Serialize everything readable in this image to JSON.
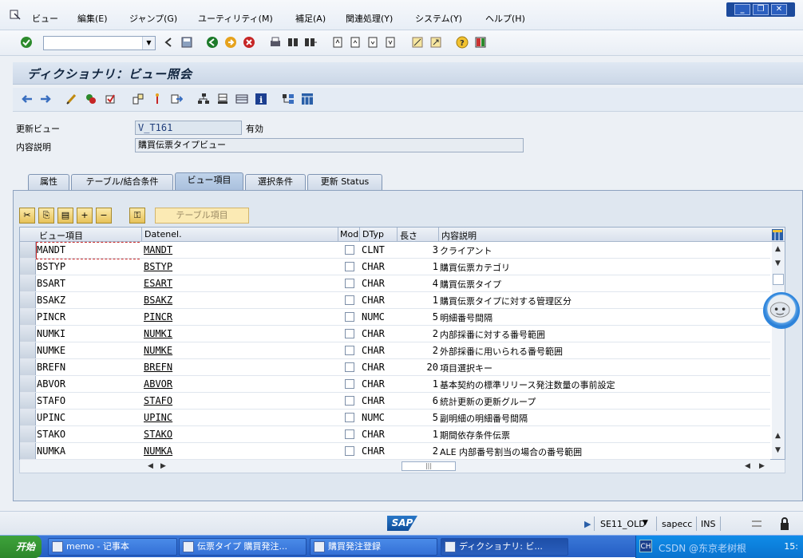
{
  "menu": {
    "items": [
      "ビュー",
      "編集(E)",
      "ジャンプ(G)",
      "ユーティリティ(M)",
      "補足(A)",
      "関連処理(Y)",
      "システム(Y)",
      "ヘルプ(H)"
    ]
  },
  "window_controls": {
    "minimize": "_",
    "restore": "❐",
    "close": "✕"
  },
  "toolbar": {
    "command_field_value": "",
    "icons": [
      "enter-check-icon",
      "back-icon",
      "save-icon",
      "back-green-icon",
      "exit-icon",
      "cancel-icon",
      "print-icon",
      "find-icon",
      "find-next-icon",
      "first-page-icon",
      "prev-page-icon",
      "next-page-icon",
      "last-page-icon",
      "new-session-icon",
      "shortcut-icon",
      "help-icon",
      "layout-icon"
    ]
  },
  "title": "ディクショナリ：ビュー照会",
  "form": {
    "view_label": "更新ビュー",
    "view_value": "V_T161",
    "view_status": "有効",
    "desc_label": "内容説明",
    "desc_value": "購買伝票タイプビュー"
  },
  "tabs": [
    "属性",
    "テーブル/結合条件",
    "ビュー項目",
    "選択条件",
    "更新 Status"
  ],
  "active_tab": "ビュー項目",
  "table_button": "テーブル項目",
  "grid": {
    "columns": [
      "ビュー項目",
      "Datenel.",
      "Mod",
      "DTyp",
      "長さ",
      "内容説明"
    ],
    "rows": [
      {
        "view_field": "MANDT",
        "data_element": "MANDT",
        "dtype": "CLNT",
        "length": "3",
        "description": "クライアント"
      },
      {
        "view_field": "BSTYP",
        "data_element": "BSTYP",
        "dtype": "CHAR",
        "length": "1",
        "description": "購買伝票カテゴリ"
      },
      {
        "view_field": "BSART",
        "data_element": "ESART",
        "dtype": "CHAR",
        "length": "4",
        "description": "購買伝票タイプ"
      },
      {
        "view_field": "BSAKZ",
        "data_element": "BSAKZ",
        "dtype": "CHAR",
        "length": "1",
        "description": "購買伝票タイプに対する管理区分"
      },
      {
        "view_field": "PINCR",
        "data_element": "PINCR",
        "dtype": "NUMC",
        "length": "5",
        "description": "明細番号間隔"
      },
      {
        "view_field": "NUMKI",
        "data_element": "NUMKI",
        "dtype": "CHAR",
        "length": "2",
        "description": "内部採番に対する番号範囲"
      },
      {
        "view_field": "NUMKE",
        "data_element": "NUMKE",
        "dtype": "CHAR",
        "length": "2",
        "description": "外部採番に用いられる番号範囲"
      },
      {
        "view_field": "BREFN",
        "data_element": "BREFN",
        "dtype": "CHAR",
        "length": "20",
        "description": "項目選択キー"
      },
      {
        "view_field": "ABVOR",
        "data_element": "ABVOR",
        "dtype": "CHAR",
        "length": "1",
        "description": "基本契約の標準リリース発注数量の事前設定"
      },
      {
        "view_field": "STAFO",
        "data_element": "STAFO",
        "dtype": "CHAR",
        "length": "6",
        "description": "統計更新の更新グループ"
      },
      {
        "view_field": "UPINC",
        "data_element": "UPINC",
        "dtype": "NUMC",
        "length": "5",
        "description": "副明細の明細番号間隔"
      },
      {
        "view_field": "STAKO",
        "data_element": "STAKO",
        "dtype": "CHAR",
        "length": "1",
        "description": "期間依存条件伝票"
      },
      {
        "view_field": "NUMKA",
        "data_element": "NUMKA",
        "dtype": "CHAR",
        "length": "2",
        "description": "ALE 内部番号割当の場合の番号範囲"
      }
    ]
  },
  "status": {
    "transaction": "SE11_OLD",
    "server": "sapecc",
    "mode": "INS"
  },
  "taskbar": {
    "start": "开始",
    "tasks": [
      "memo - 记事本",
      "伝票タイプ 購買発注...",
      "購買発注登録",
      "ディクショナリ: ビ..."
    ],
    "tray_text": "CH",
    "clock": "15:",
    "watermark": "CSDN @东京老树根"
  },
  "colors": {
    "accent": "#1c4a9c",
    "tab_active": "#a9c0dd",
    "panel": "#dfe7f0"
  }
}
